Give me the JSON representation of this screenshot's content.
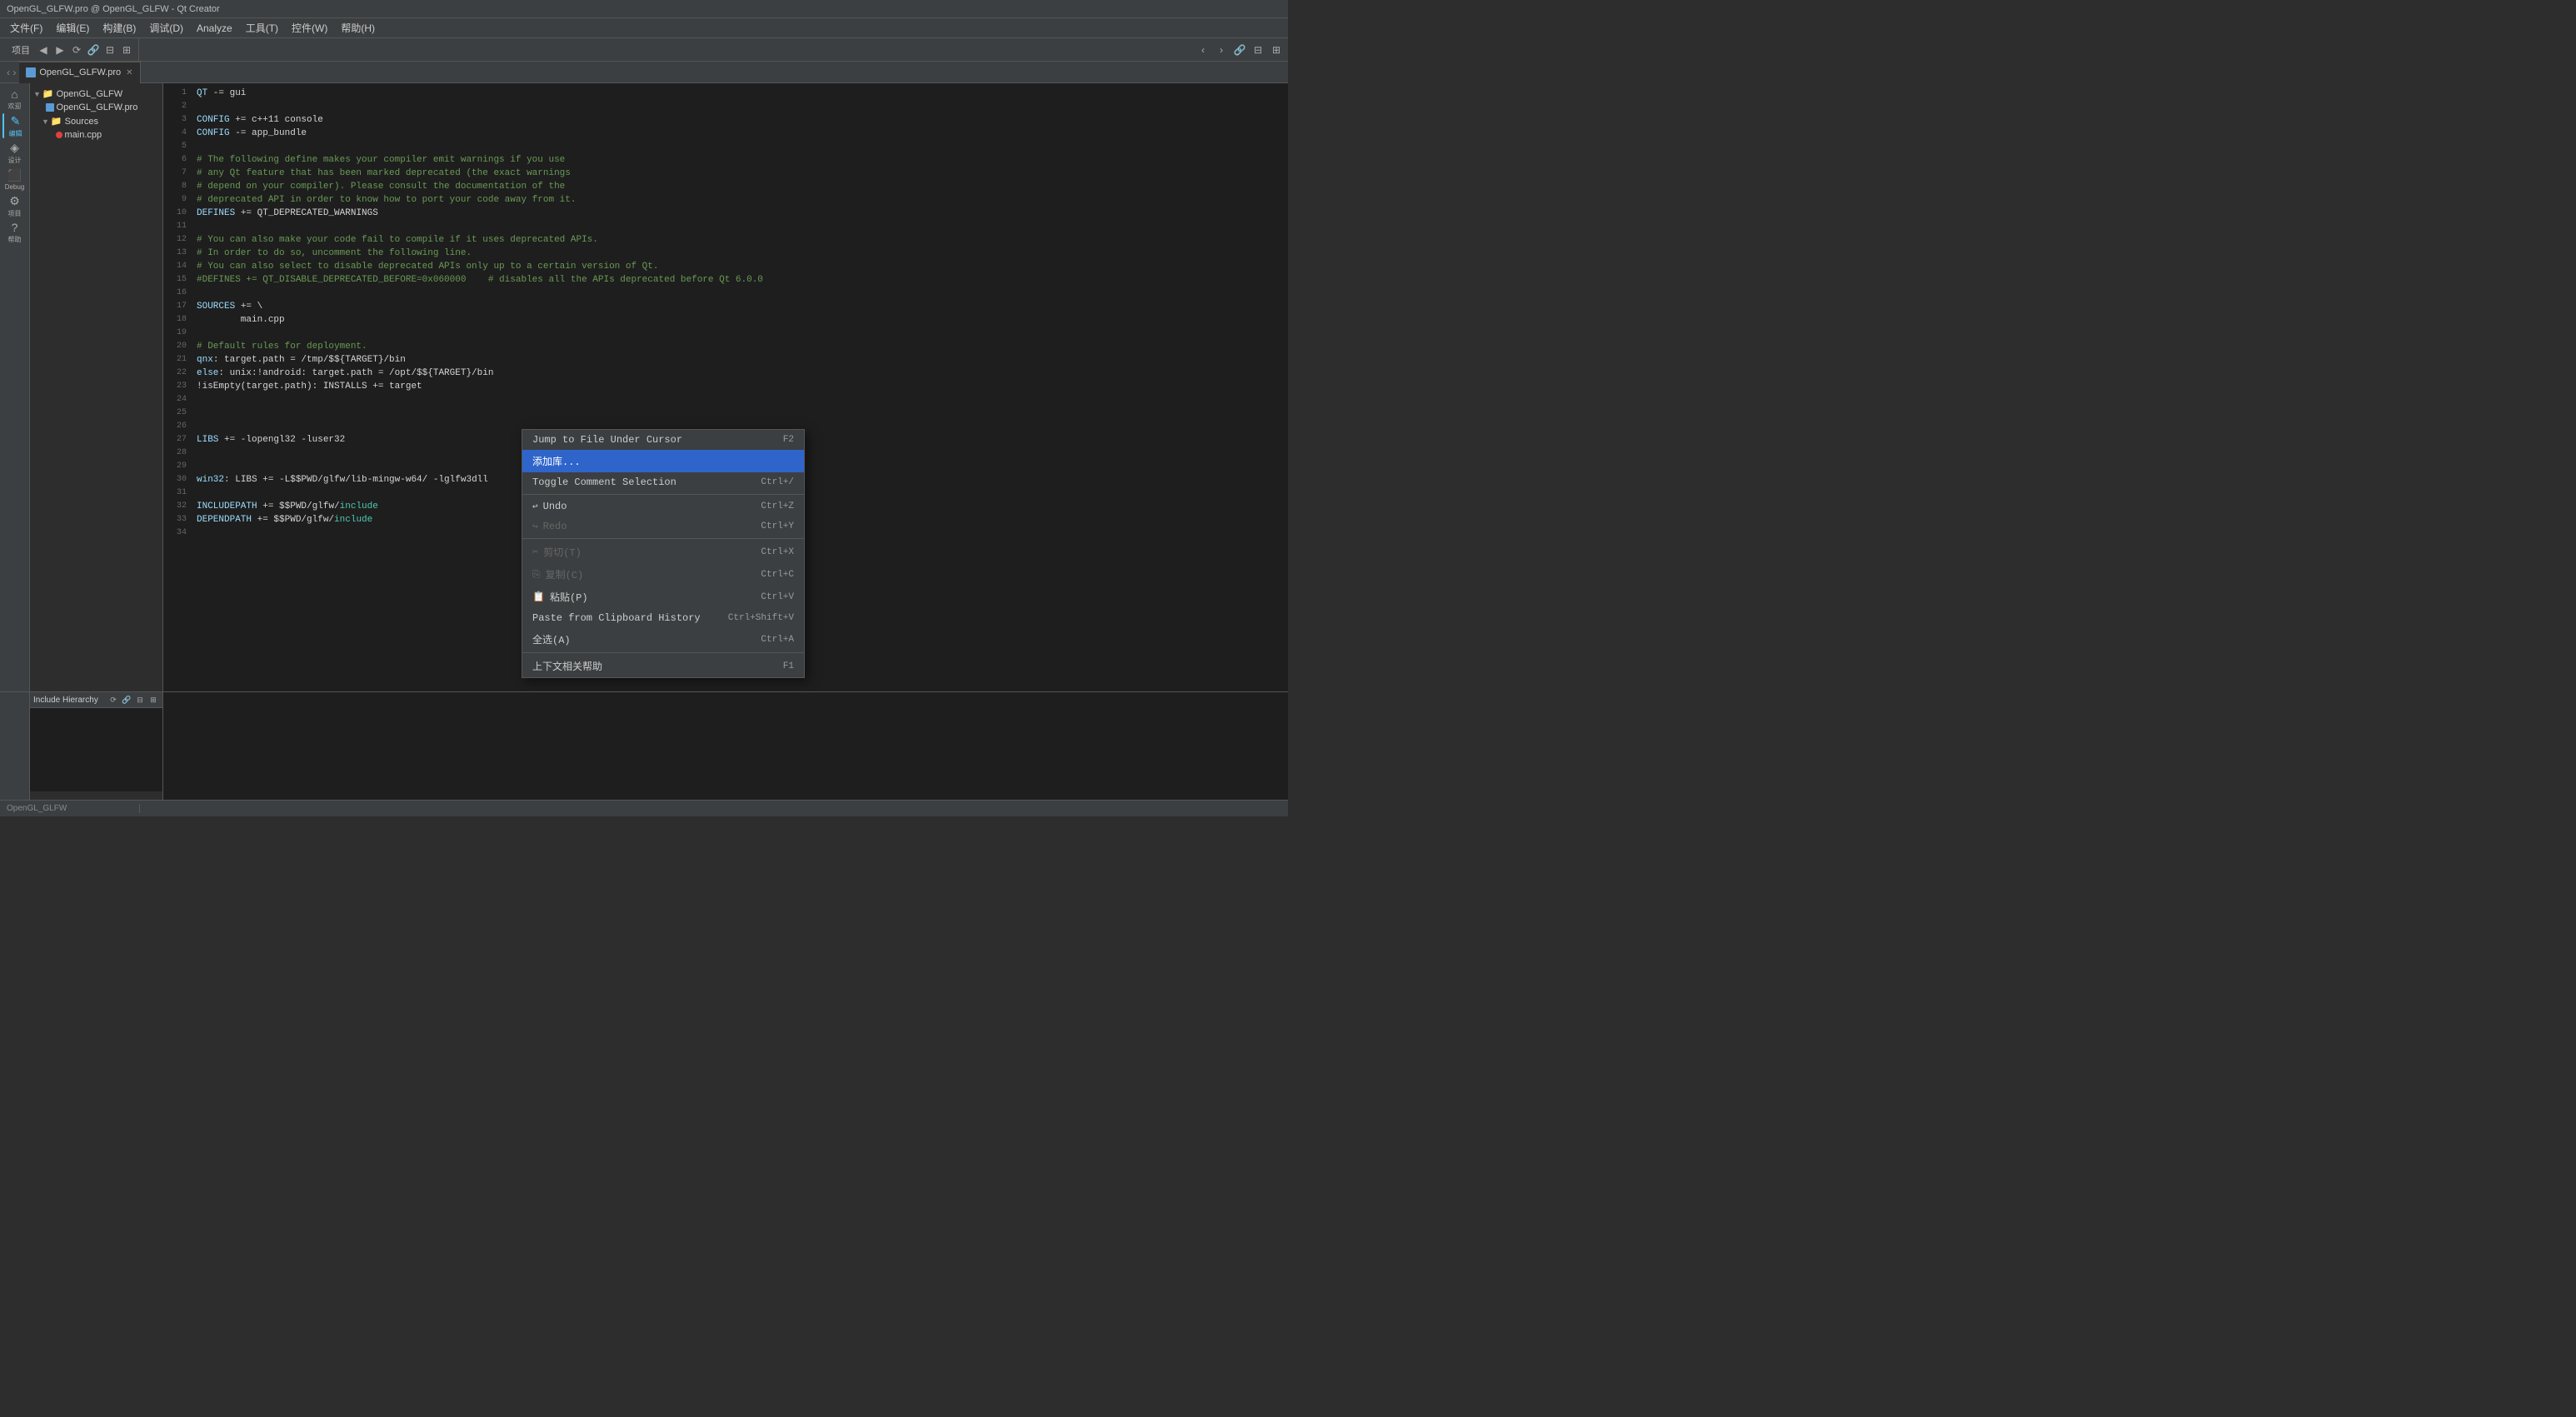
{
  "titleBar": {
    "text": "OpenGL_GLFW.pro @ OpenGL_GLFW - Qt Creator"
  },
  "menuBar": {
    "items": [
      "文件(F)",
      "编辑(E)",
      "构建(B)",
      "调试(D)",
      "Analyze",
      "工具(T)",
      "控件(W)",
      "帮助(H)"
    ]
  },
  "toolbar": {
    "projectLabel": "项目",
    "backLabel": "◀",
    "forwardLabel": "▶"
  },
  "tab": {
    "label": "OpenGL_GLFW.pro",
    "closeLabel": "✕"
  },
  "fileTree": {
    "items": [
      {
        "label": "OpenGL_GLFW",
        "type": "root",
        "indent": 0,
        "arrow": "▼"
      },
      {
        "label": "OpenGL_GLFW.pro",
        "type": "pro",
        "indent": 1,
        "arrow": ""
      },
      {
        "label": "Sources",
        "type": "folder",
        "indent": 1,
        "arrow": "▼"
      },
      {
        "label": "main.cpp",
        "type": "error",
        "indent": 2,
        "arrow": ""
      }
    ]
  },
  "sidebarIcons": [
    {
      "name": "welcome-icon",
      "symbol": "⌂",
      "label": "欢迎"
    },
    {
      "name": "edit-icon",
      "symbol": "✎",
      "label": "编辑",
      "active": true
    },
    {
      "name": "design-icon",
      "symbol": "◈",
      "label": "设计"
    },
    {
      "name": "debug-icon",
      "symbol": "⬛",
      "label": "Debug"
    },
    {
      "name": "project-icon",
      "symbol": "⚙",
      "label": "项目"
    },
    {
      "name": "help-icon",
      "symbol": "?",
      "label": "帮助"
    }
  ],
  "codeLines": [
    {
      "num": 1,
      "content": "QT -= gui",
      "tokens": [
        {
          "text": "QT",
          "cls": "kw-defines"
        },
        {
          "text": " -= gui",
          "cls": ""
        }
      ]
    },
    {
      "num": 2,
      "content": ""
    },
    {
      "num": 3,
      "content": "CONFIG += c++11 console",
      "tokens": [
        {
          "text": "CONFIG",
          "cls": "kw-defines"
        },
        {
          "text": " += c++11 console",
          "cls": ""
        }
      ]
    },
    {
      "num": 4,
      "content": "CONFIG -= app_bundle",
      "tokens": [
        {
          "text": "CONFIG",
          "cls": "kw-defines"
        },
        {
          "text": " -= app_bundle",
          "cls": ""
        }
      ]
    },
    {
      "num": 5,
      "content": ""
    },
    {
      "num": 6,
      "content": "# The following define makes your compiler emit warnings if you use",
      "tokens": [
        {
          "text": "# The following define makes your compiler emit warnings if you use",
          "cls": "kw-green"
        }
      ]
    },
    {
      "num": 7,
      "content": "# any Qt feature that has been marked deprecated (the exact warnings",
      "tokens": [
        {
          "text": "# any Qt feature that has been marked deprecated (the exact warnings",
          "cls": "kw-green"
        }
      ]
    },
    {
      "num": 8,
      "content": "# depend on your compiler). Please consult the documentation of the",
      "tokens": [
        {
          "text": "# depend on your compiler). Please consult the documentation of the",
          "cls": "kw-green"
        }
      ]
    },
    {
      "num": 9,
      "content": "# deprecated API in order to know how to port your code away from it.",
      "tokens": [
        {
          "text": "# deprecated API in order to know how to port your code away from it.",
          "cls": "kw-green"
        }
      ]
    },
    {
      "num": 10,
      "content": "DEFINES += QT_DEPRECATED_WARNINGS",
      "tokens": [
        {
          "text": "DEFINES",
          "cls": "kw-defines"
        },
        {
          "text": " += QT_DEPRECATED_WARNINGS",
          "cls": ""
        }
      ]
    },
    {
      "num": 11,
      "content": ""
    },
    {
      "num": 12,
      "content": "# You can also make your code fail to compile if it uses deprecated APIs.",
      "tokens": [
        {
          "text": "# You can also make your code fail to compile if it uses deprecated APIs.",
          "cls": "kw-green"
        }
      ]
    },
    {
      "num": 13,
      "content": "# In order to do so, uncomment the following line.",
      "tokens": [
        {
          "text": "# In order to do so, uncomment the following line.",
          "cls": "kw-green"
        }
      ]
    },
    {
      "num": 14,
      "content": "# You can also select to disable deprecated APIs only up to a certain version of Qt.",
      "tokens": [
        {
          "text": "# You can also select to disable deprecated APIs only up to a certain version of Qt.",
          "cls": "kw-green"
        }
      ]
    },
    {
      "num": 15,
      "content": "#DEFINES += QT_DISABLE_DEPRECATED_BEFORE=0x060000    # disables all the APIs deprecated before Qt 6.0.0",
      "tokens": [
        {
          "text": "#DEFINES += QT_DISABLE_DEPRECATED_BEFORE=0x060000    # disables all the APIs deprecated before Qt 6.0.0",
          "cls": "kw-green"
        }
      ]
    },
    {
      "num": 16,
      "content": ""
    },
    {
      "num": 17,
      "content": "SOURCES += \\",
      "tokens": [
        {
          "text": "SOURCES",
          "cls": "kw-defines"
        },
        {
          "text": " += \\",
          "cls": ""
        }
      ]
    },
    {
      "num": 18,
      "content": "        main.cpp",
      "tokens": [
        {
          "text": "        main.cpp",
          "cls": ""
        }
      ]
    },
    {
      "num": 19,
      "content": ""
    },
    {
      "num": 20,
      "content": "# Default rules for deployment.",
      "tokens": [
        {
          "text": "# Default rules for deployment.",
          "cls": "kw-green"
        }
      ]
    },
    {
      "num": 21,
      "content": "qnx: target.path = /tmp/$${TARGET}/bin",
      "tokens": [
        {
          "text": "qnx",
          "cls": "kw-defines"
        },
        {
          "text": ": target.path = /tmp/$${TARGET}/bin",
          "cls": ""
        }
      ]
    },
    {
      "num": 22,
      "content": "else: unix:!android: target.path = /opt/$${TARGET}/bin",
      "tokens": [
        {
          "text": "else",
          "cls": "kw-defines"
        },
        {
          "text": ": unix:!android: target.path = /opt/$${TARGET}/bin",
          "cls": ""
        }
      ]
    },
    {
      "num": 23,
      "content": "!isEmpty(target.path): INSTALLS += target",
      "tokens": [
        {
          "text": "!isEmpty(target.path): INSTALLS += target",
          "cls": ""
        }
      ]
    },
    {
      "num": 24,
      "content": ""
    },
    {
      "num": 25,
      "content": ""
    },
    {
      "num": 26,
      "content": ""
    },
    {
      "num": 27,
      "content": "LIBS += -lopengl32 -luser32",
      "tokens": [
        {
          "text": "LIBS",
          "cls": "kw-defines"
        },
        {
          "text": " += -lopengl32 -luser32",
          "cls": ""
        }
      ]
    },
    {
      "num": 28,
      "content": ""
    },
    {
      "num": 29,
      "content": ""
    },
    {
      "num": 30,
      "content": "win32: LIBS += -L$$PWD/glfw/lib-mingw-w64/ -lglfw3dll",
      "tokens": [
        {
          "text": "win32",
          "cls": "kw-defines"
        },
        {
          "text": ": LIBS += -L$$PWD/glfw/lib-mingw-w64/ -lglfw3dll",
          "cls": ""
        }
      ]
    },
    {
      "num": 31,
      "content": ""
    },
    {
      "num": 32,
      "content": "INCLUDEPATH += $$PWD/glfw/include",
      "tokens": [
        {
          "text": "INCLUDEPATH",
          "cls": "kw-defines"
        },
        {
          "text": " += $$PWD/glfw/",
          "cls": ""
        },
        {
          "text": "include",
          "cls": "kw-cyan"
        }
      ]
    },
    {
      "num": 33,
      "content": "DEPENDPATH += $$PWD/glfw/include",
      "tokens": [
        {
          "text": "DEPENDPATH",
          "cls": "kw-defines"
        },
        {
          "text": " += $$PWD/glfw/",
          "cls": ""
        },
        {
          "text": "include",
          "cls": "kw-cyan"
        }
      ]
    },
    {
      "num": 34,
      "content": ""
    }
  ],
  "contextMenu": {
    "items": [
      {
        "label": "Jump to File Under Cursor",
        "shortcut": "F2",
        "active": false,
        "disabled": false,
        "icon": ""
      },
      {
        "label": "添加库...",
        "shortcut": "",
        "active": true,
        "disabled": false,
        "icon": ""
      },
      {
        "label": "Toggle Comment Selection",
        "shortcut": "Ctrl+/",
        "active": false,
        "disabled": false,
        "icon": ""
      },
      {
        "label": "divider1",
        "type": "divider"
      },
      {
        "label": "Undo",
        "shortcut": "Ctrl+Z",
        "active": false,
        "disabled": false,
        "icon": "↩"
      },
      {
        "label": "Redo",
        "shortcut": "Ctrl+Y",
        "active": false,
        "disabled": true,
        "icon": "↪"
      },
      {
        "label": "divider2",
        "type": "divider"
      },
      {
        "label": "剪切(T)",
        "shortcut": "Ctrl+X",
        "active": false,
        "disabled": true,
        "icon": "✂"
      },
      {
        "label": "复制(C)",
        "shortcut": "Ctrl+C",
        "active": false,
        "disabled": true,
        "icon": "⎘"
      },
      {
        "label": "粘贴(P)",
        "shortcut": "Ctrl+V",
        "active": false,
        "disabled": false,
        "icon": "📋"
      },
      {
        "label": "Paste from Clipboard History",
        "shortcut": "Ctrl+Shift+V",
        "active": false,
        "disabled": false,
        "icon": ""
      },
      {
        "label": "全选(A)",
        "shortcut": "Ctrl+A",
        "active": false,
        "disabled": false,
        "icon": ""
      },
      {
        "label": "divider3",
        "type": "divider"
      },
      {
        "label": "上下文相关帮助",
        "shortcut": "F1",
        "active": false,
        "disabled": false,
        "icon": ""
      }
    ]
  },
  "hierarchyPanel": {
    "title": "Include Hierarchy"
  },
  "bottomBar": {
    "text": "OpenGL_GLFW"
  }
}
